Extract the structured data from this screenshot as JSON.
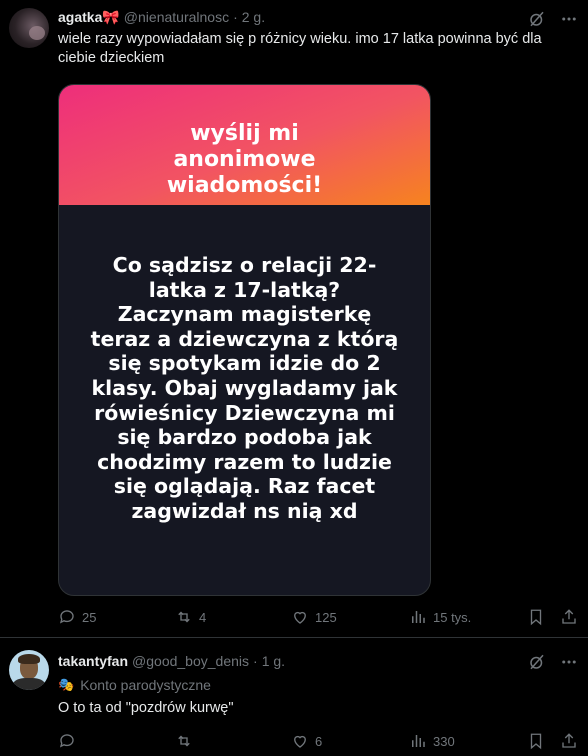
{
  "tweet1": {
    "name": "agatka🎀",
    "handle": "@nienaturalnosc",
    "time": "2 g.",
    "text": "wiele razy wypowiadałam się p różnicy wieku. imo 17 latka powinna być dla ciebie dzieckiem",
    "image": {
      "header": "wyślij mi anonimowe wiadomości!",
      "question": "Co sądzisz o relacji 22-latka z 17-latką? Zaczynam magisterkę teraz a dziewczyna z którą się spotykam idzie do 2 klasy. Obaj wygladamy jak rówieśnicy Dziewczyna mi się bardzo podoba jak chodzimy razem to ludzie się oglądają. Raz facet zagwizdał ns nią xd"
    },
    "replies": "25",
    "reposts": "4",
    "likes": "125",
    "views": "15 tys."
  },
  "tweet2": {
    "name": "takantyfan",
    "handle": "@good_boy_denis",
    "time": "1 g.",
    "parody_label": "Konto parodystyczne",
    "text": "O to ta od \"pozdrów kurwę\"",
    "replies": "",
    "reposts": "",
    "likes": "6",
    "views": "330"
  },
  "icons": [
    "reply-icon",
    "repost-icon",
    "like-icon",
    "views-icon",
    "bookmark-icon",
    "share-icon",
    "grok-icon",
    "more-icon",
    "parody-mask-icon"
  ],
  "colors": {
    "background": "#000000",
    "text": "#e7e9ea",
    "muted": "#71767b",
    "divider": "#2f3336"
  }
}
